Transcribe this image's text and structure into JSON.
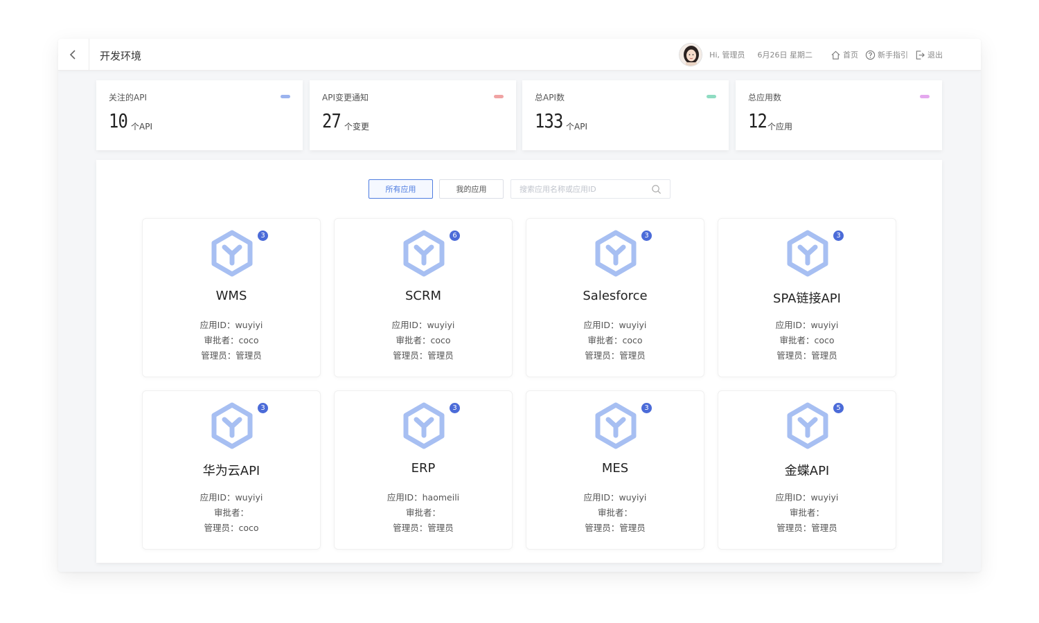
{
  "header": {
    "env_title": "开发环境",
    "greeting": "Hi, 管理员",
    "date": "6月26日 星期二",
    "home_label": "首页",
    "guide_label": "新手指引",
    "logout_label": "退出"
  },
  "stats": [
    {
      "label": "关注的API",
      "value": "10",
      "unit": "个API",
      "color": "#9bb3ee"
    },
    {
      "label": "API变更通知",
      "value": "27",
      "unit": "个变更",
      "color": "#f0a3a3"
    },
    {
      "label": "总API数",
      "value": "133",
      "unit": "个API",
      "color": "#8fdcc2"
    },
    {
      "label": "总应用数",
      "value": "12",
      "unit": "个应用",
      "color": "#e4a8ee"
    }
  ],
  "filters": {
    "all_apps": "所有应用",
    "my_apps": "我的应用",
    "search_placeholder": "搜索应用名称或应用ID"
  },
  "apps": [
    {
      "name": "WMS",
      "badge": "3",
      "app_id": "应用ID：wuyiyi",
      "approver": "审批者：coco",
      "admin": "管理员：管理员"
    },
    {
      "name": "SCRM",
      "badge": "6",
      "app_id": "应用ID：wuyiyi",
      "approver": "审批者：coco",
      "admin": "管理员：管理员"
    },
    {
      "name": "Salesforce",
      "badge": "3",
      "app_id": "应用ID：wuyiyi",
      "approver": "审批者：coco",
      "admin": "管理员：管理员"
    },
    {
      "name": "SPA链接API",
      "badge": "3",
      "app_id": "应用ID：wuyiyi",
      "approver": "审批者：coco",
      "admin": "管理员：管理员"
    },
    {
      "name": "华为云API",
      "badge": "3",
      "app_id": "应用ID：wuyiyi",
      "approver": "审批者：",
      "admin": "管理员：coco"
    },
    {
      "name": "ERP",
      "badge": "3",
      "app_id": "应用ID：haomeili",
      "approver": "审批者：",
      "admin": "管理员：管理员"
    },
    {
      "name": "MES",
      "badge": "3",
      "app_id": "应用ID：wuyiyi",
      "approver": "审批者：",
      "admin": "管理员：管理员"
    },
    {
      "name": "金蝶API",
      "badge": "5",
      "app_id": "应用ID：wuyiyi",
      "approver": "审批者：",
      "admin": "管理员：管理员"
    }
  ],
  "colors": {
    "accent": "#4e7ce0",
    "badge": "#4b6bd8",
    "app_icon": "#a7bff2"
  }
}
